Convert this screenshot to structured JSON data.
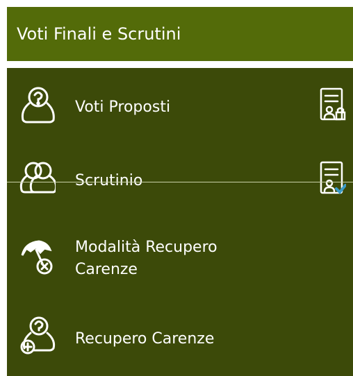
{
  "header": {
    "title": "Voti Finali e Scrutini"
  },
  "menu": {
    "items": [
      {
        "label": "Voti Proposti",
        "icon": "user-question-icon"
      },
      {
        "label": "Scrutinio",
        "icon": "users-group-icon"
      },
      {
        "label": "Modalità Recupero\nCarenze",
        "label_line1": "Modalità Recupero",
        "label_line2": "Carenze",
        "icon": "umbrella-cancel-icon"
      },
      {
        "label": "Recupero Carenze",
        "icon": "user-add-icon"
      }
    ],
    "side_icons": [
      "document-user-lock-icon",
      "document-user-check-icon"
    ]
  },
  "colors": {
    "header_bg": "#536b09",
    "panel_bg": "#3c4a09",
    "text": "#ffffff",
    "accent": "#3b9bc7"
  }
}
